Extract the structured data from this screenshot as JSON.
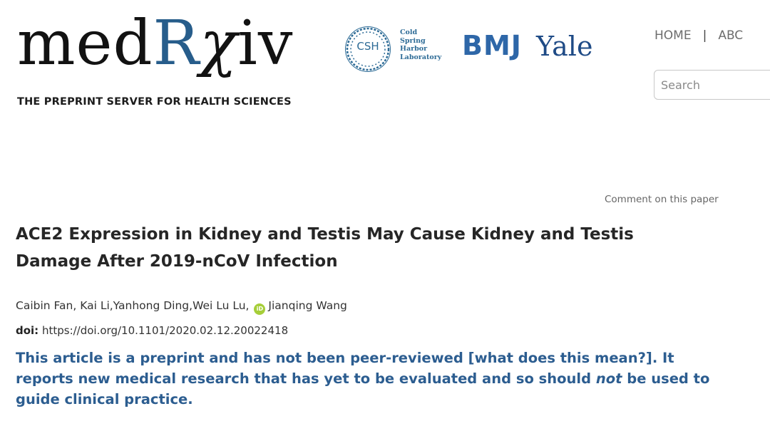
{
  "header": {
    "logo": {
      "part_med": "med",
      "part_r": "R",
      "part_chi": "χ",
      "part_iv": "iv",
      "tagline": "THE PREPRINT SERVER FOR HEALTH SCIENCES"
    },
    "partners": {
      "csh_mark": "CSH",
      "csh_lines": [
        "Cold",
        "Spring",
        "Harbor",
        "Laboratory"
      ],
      "bmj": "BMJ",
      "yale": "Yale"
    },
    "nav": {
      "home": "HOME",
      "separator": "|",
      "about": "ABC"
    },
    "search": {
      "placeholder": "Search"
    }
  },
  "article": {
    "comment_link": "Comment on this paper",
    "title": "ACE2 Expression in Kidney and Testis May Cause Kidney and Testis Damage After 2019-nCoV Infection",
    "authors_before_orcid": "Caibin Fan, Kai Li,Yanhong Ding,Wei Lu Lu,",
    "orcid_icon": "iD",
    "authors_after_orcid": "Jianqing Wang",
    "doi_label": "doi:",
    "doi_url": "https://doi.org/10.1101/2020.02.12.20022418",
    "notice_part1": "This article is a preprint and has not been peer-reviewed ",
    "notice_link": "[what does this mean?]",
    "notice_part2": ". It reports new medical research that has yet to be evaluated and so should ",
    "notice_not": "not",
    "notice_part3": " be used to guide clinical practice."
  },
  "colors": {
    "brand_blue": "#275d8b",
    "notice_blue": "#2c5d90",
    "bmj_blue": "#2e67a8",
    "yale_blue": "#1f4b86",
    "orcid_green": "#a6ce39"
  }
}
